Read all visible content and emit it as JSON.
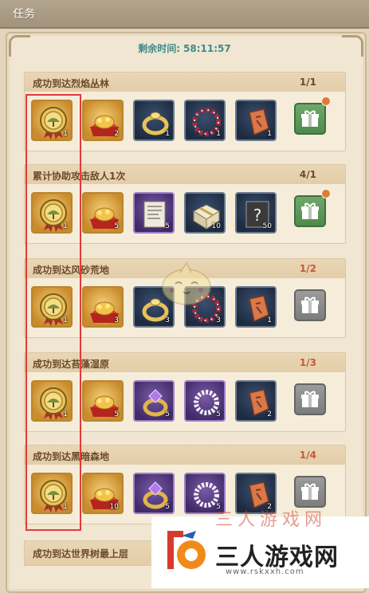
{
  "window": {
    "title": "任务"
  },
  "timer": {
    "label": "剩余时间:",
    "value": "58:11:57"
  },
  "tasks": [
    {
      "name": "成功到达烈焰丛林",
      "progress": "1/1",
      "complete": true,
      "gift_state": "claimable",
      "rewards": [
        {
          "icon": "medal-icon",
          "bg": "gold",
          "count": "1"
        },
        {
          "icon": "treasure-icon",
          "bg": "gold",
          "count": "2"
        },
        {
          "icon": "ring-icon",
          "bg": "blue",
          "count": "1"
        },
        {
          "icon": "wreath-icon",
          "bg": "blue",
          "count": "1"
        },
        {
          "icon": "rune-stone-icon",
          "bg": "blue",
          "count": "1"
        }
      ]
    },
    {
      "name": "累计协助攻击敌人1次",
      "progress": "4/1",
      "complete": true,
      "gift_state": "claimable",
      "rewards": [
        {
          "icon": "medal-icon",
          "bg": "gold",
          "count": "1"
        },
        {
          "icon": "treasure-icon",
          "bg": "gold",
          "count": "5"
        },
        {
          "icon": "document-icon",
          "bg": "purple",
          "count": "5"
        },
        {
          "icon": "parcel-icon",
          "bg": "blue",
          "count": "10"
        },
        {
          "icon": "mystery-book-icon",
          "bg": "blue",
          "count": "50"
        }
      ]
    },
    {
      "name": "成功到达风砂荒地",
      "progress": "1/2",
      "complete": false,
      "gift_state": "locked",
      "rewards": [
        {
          "icon": "medal-icon",
          "bg": "gold",
          "count": "1"
        },
        {
          "icon": "treasure-icon",
          "bg": "gold",
          "count": "3"
        },
        {
          "icon": "ring-icon",
          "bg": "blue",
          "count": "3"
        },
        {
          "icon": "wreath-icon",
          "bg": "blue",
          "count": "3"
        },
        {
          "icon": "rune-stone-icon",
          "bg": "blue",
          "count": "1"
        }
      ]
    },
    {
      "name": "成功到达苔藻湿原",
      "progress": "1/3",
      "complete": false,
      "gift_state": "locked",
      "rewards": [
        {
          "icon": "medal-icon",
          "bg": "gold",
          "count": "1"
        },
        {
          "icon": "treasure-icon",
          "bg": "gold",
          "count": "5"
        },
        {
          "icon": "gem-ring-icon",
          "bg": "purple",
          "count": "5"
        },
        {
          "icon": "pearl-bracelet-icon",
          "bg": "purple",
          "count": "5"
        },
        {
          "icon": "rune-stone-icon",
          "bg": "blue",
          "count": "2"
        }
      ]
    },
    {
      "name": "成功到达黑暗森地",
      "progress": "1/4",
      "complete": false,
      "gift_state": "locked",
      "rewards": [
        {
          "icon": "medal-icon",
          "bg": "gold",
          "count": "1"
        },
        {
          "icon": "treasure-icon",
          "bg": "gold",
          "count": "10"
        },
        {
          "icon": "gem-ring-icon",
          "bg": "purple",
          "count": "5"
        },
        {
          "icon": "pearl-bracelet-icon",
          "bg": "purple",
          "count": "5"
        },
        {
          "icon": "rune-stone-icon",
          "bg": "blue",
          "count": "2"
        }
      ]
    }
  ],
  "partial_task": {
    "name": "成功到达世界树最上层"
  },
  "watermark": {
    "text": "三人游戏网",
    "url": "www.rskxxh.com",
    "ghost_text": "三人游戏网"
  },
  "colors": {
    "accent_teal": "#3f8a8a",
    "progress_red": "#c55a3a",
    "highlight_red": "#e23a3a",
    "gift_green": "#4f8a4c"
  }
}
